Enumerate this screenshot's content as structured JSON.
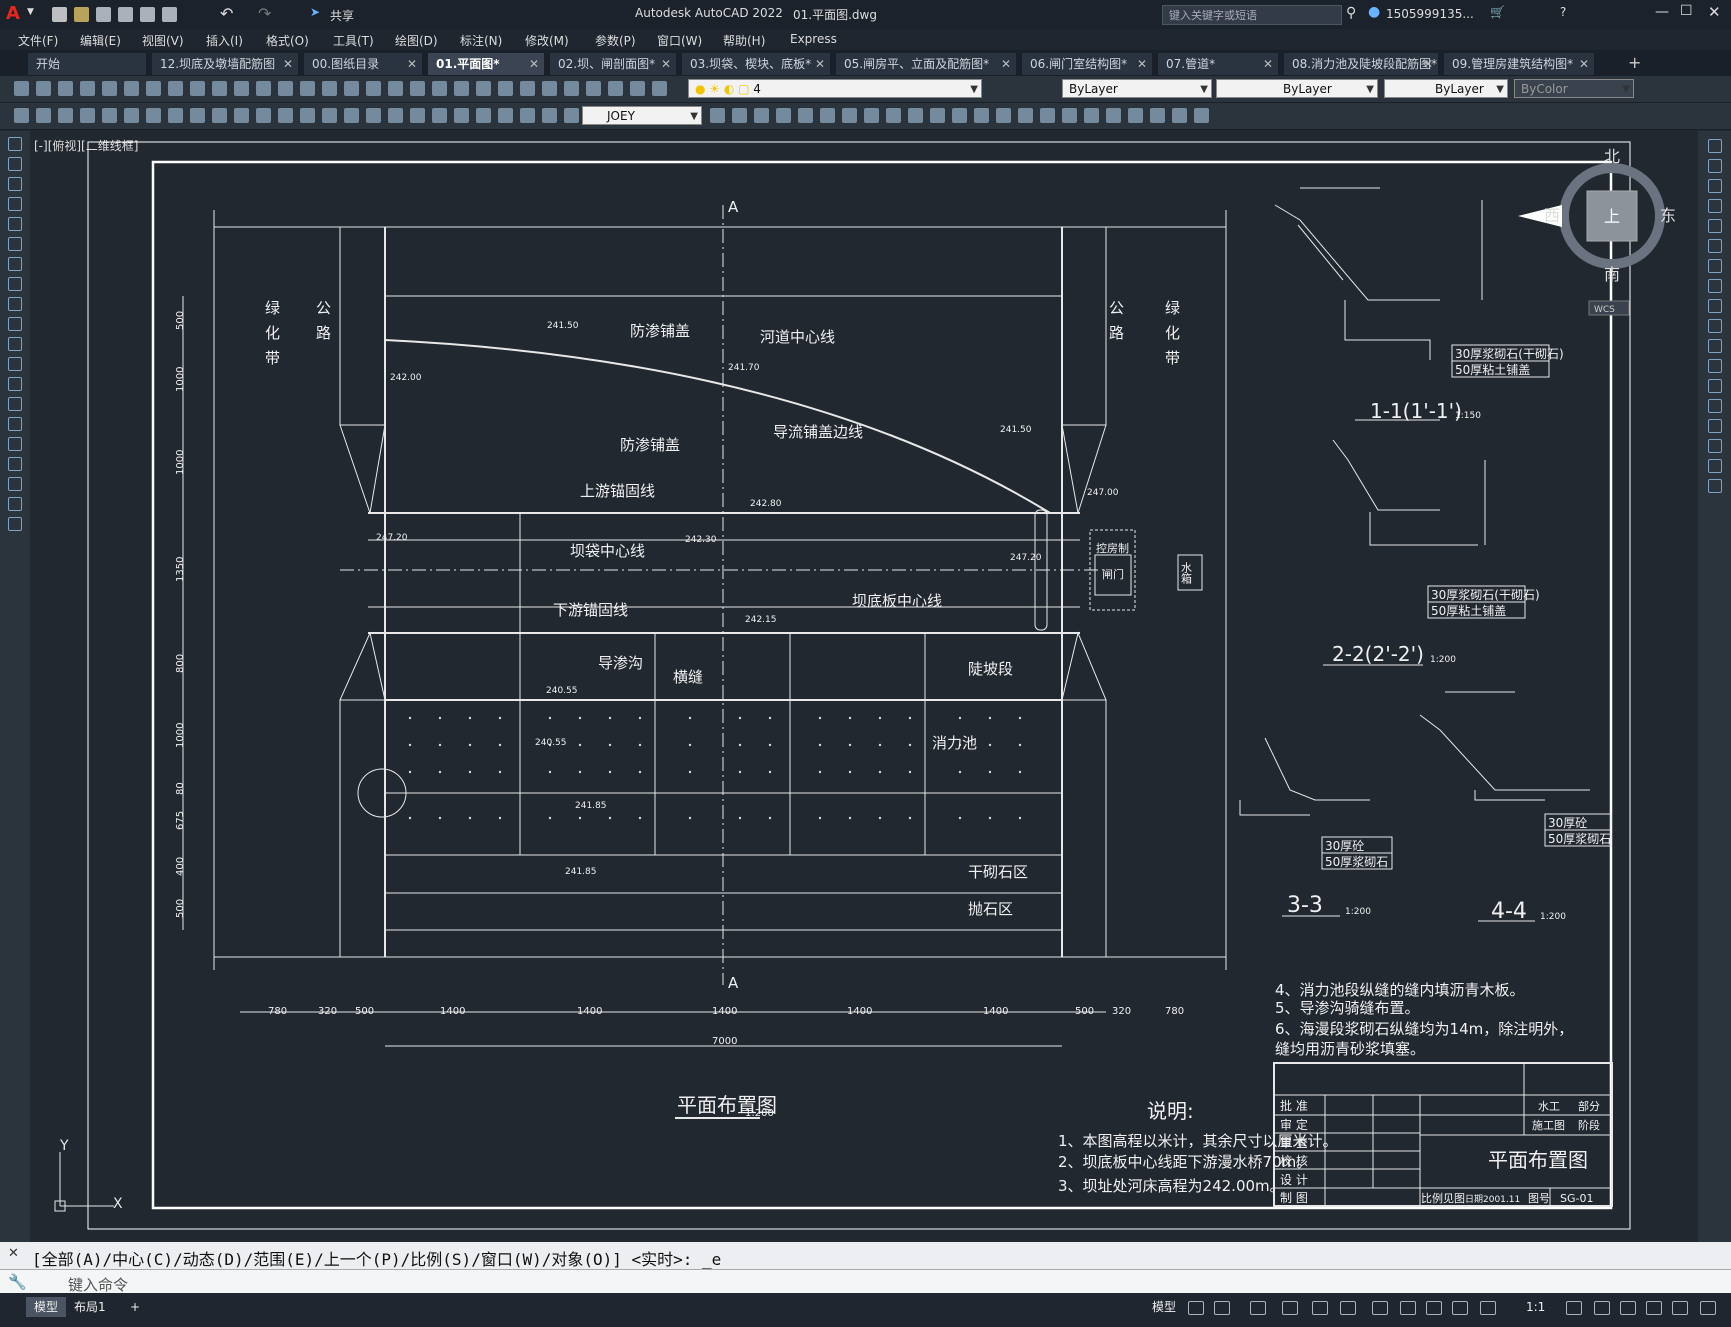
{
  "app": {
    "title": "Autodesk AutoCAD 2022",
    "filename": "01.平面图.dwg",
    "share": "共享",
    "search_placeholder": "键入关键字或短语",
    "user": "1505999135...",
    "accent": "#e8261c"
  },
  "menu": [
    "文件(F)",
    "编辑(E)",
    "视图(V)",
    "插入(I)",
    "格式(O)",
    "工具(T)",
    "绘图(D)",
    "标注(N)",
    "修改(M)",
    "参数(P)",
    "窗口(W)",
    "帮助(H)",
    "Express"
  ],
  "tabs": [
    {
      "label": "开始",
      "active": false
    },
    {
      "label": "12.坝底及墩墙配筋图",
      "active": false
    },
    {
      "label": "00.图纸目录",
      "active": false
    },
    {
      "label": "01.平面图*",
      "active": true
    },
    {
      "label": "02.坝、闸剖面图*",
      "active": false
    },
    {
      "label": "03.坝袋、楔块、底板*",
      "active": false
    },
    {
      "label": "05.闸房平、立面及配筋图*",
      "active": false
    },
    {
      "label": "06.闸门室结构图*",
      "active": false
    },
    {
      "label": "07.管道*",
      "active": false
    },
    {
      "label": "08.消力池及陡坡段配筋图*",
      "active": false
    },
    {
      "label": "09.管理房建筑结构图*",
      "active": false
    }
  ],
  "toolbar": {
    "layer": "4",
    "color": "ByLayer",
    "linetype": "ByLayer",
    "lineweight": "ByLayer",
    "plotstyle": "ByColor",
    "textstyle": "JOEY"
  },
  "viewport_label": "[-][俯视][二维线框]",
  "viewcube": {
    "north": "北",
    "south": "南",
    "east": "东",
    "west": "西",
    "top": "上",
    "wcs": "WCS"
  },
  "drawing": {
    "main_title": "平面布置图",
    "main_scale": "1:200",
    "sections": [
      {
        "name": "1-1(1'-1')",
        "scale": "1:150"
      },
      {
        "name": "2-2(2'-2')",
        "scale": "1:200"
      },
      {
        "name": "3-3",
        "scale": "1:200"
      },
      {
        "name": "4-4",
        "scale": "1:200"
      }
    ],
    "labels": {
      "green_left": "绿化带",
      "road_left": "公路",
      "green_right": "绿化带",
      "road_right": "公路",
      "cover1": "防渗铺盖",
      "cover2": "防渗铺盖",
      "river_center": "河道中心线",
      "guide_edge": "导流铺盖边线",
      "up_anchor": "上游锚固线",
      "bag_center": "坝袋中心线",
      "down_anchor": "下游锚固线",
      "floor_center": "坝底板中心线",
      "drain": "导渗沟",
      "cross": "横缝",
      "steep": "陡坡段",
      "basin": "消力池",
      "dry_stone": "干砌石区",
      "riprap": "抛石区",
      "ctrl_room": "控房制",
      "gate": "闸门",
      "pool": "水箱",
      "sec_a": "A"
    },
    "elevations": [
      "241.50",
      "242.00",
      "241.70",
      "241.50",
      "242.80",
      "242.30",
      "247.20",
      "242.15",
      "247.20",
      "240.55",
      "240.55",
      "241.85",
      "241.85",
      "247.00"
    ],
    "bottom_dims": [
      "780",
      "320",
      "500",
      "1400",
      "1400",
      "1400",
      "1400",
      "1400",
      "500",
      "320",
      "780"
    ],
    "total_dim": "7000",
    "left_dims": [
      "500",
      "1000",
      "1000",
      "1350",
      "800",
      "1000",
      "80",
      "675",
      "400",
      "500"
    ],
    "sec11_notes": [
      "30厚浆砌石(干砌石)",
      "50厚粘土铺盖"
    ],
    "sec22_notes": [
      "30厚浆砌石(干砌石)",
      "50厚粘土铺盖"
    ],
    "sec33_notes": [
      "30厚砼",
      "50厚浆砌石"
    ],
    "sec44_notes": [
      "30厚砼",
      "50厚浆砌石"
    ],
    "notes_title": "说明:",
    "notes": [
      "1、本图高程以米计，其余尺寸以厘米计。",
      "2、坝底板中心线距下游漫水桥70m。",
      "3、坝址处河床高程为242.00m。"
    ],
    "notes_right": [
      "4、消力池段纵缝的缝内填沥青木板。",
      "5、导渗沟骑缝布置。",
      "6、海漫段浆砌石纵缝均为14m，除注明外，",
      "   缝均用沥青砂浆填塞。"
    ],
    "titleblock": {
      "rows": [
        "批  准",
        "审  定",
        "审  查",
        "校  核",
        "设  计",
        "制  图"
      ],
      "dept1": "水工",
      "dept1b": "部分",
      "dept2": "施工图",
      "dept2b": "阶段",
      "title": "平面布置图",
      "scale": "比例见图",
      "date": "日期2001.11",
      "drawno_label": "图号",
      "drawno": "SG-01"
    }
  },
  "command": {
    "line": "[全部(A)/中心(C)/动态(D)/范围(E)/上一个(P)/比例(S)/窗口(W)/对象(O)] <实时>: _e",
    "placeholder": "键入命令"
  },
  "status": {
    "model": "模型",
    "layout": "布局1",
    "scale": "1:1"
  }
}
